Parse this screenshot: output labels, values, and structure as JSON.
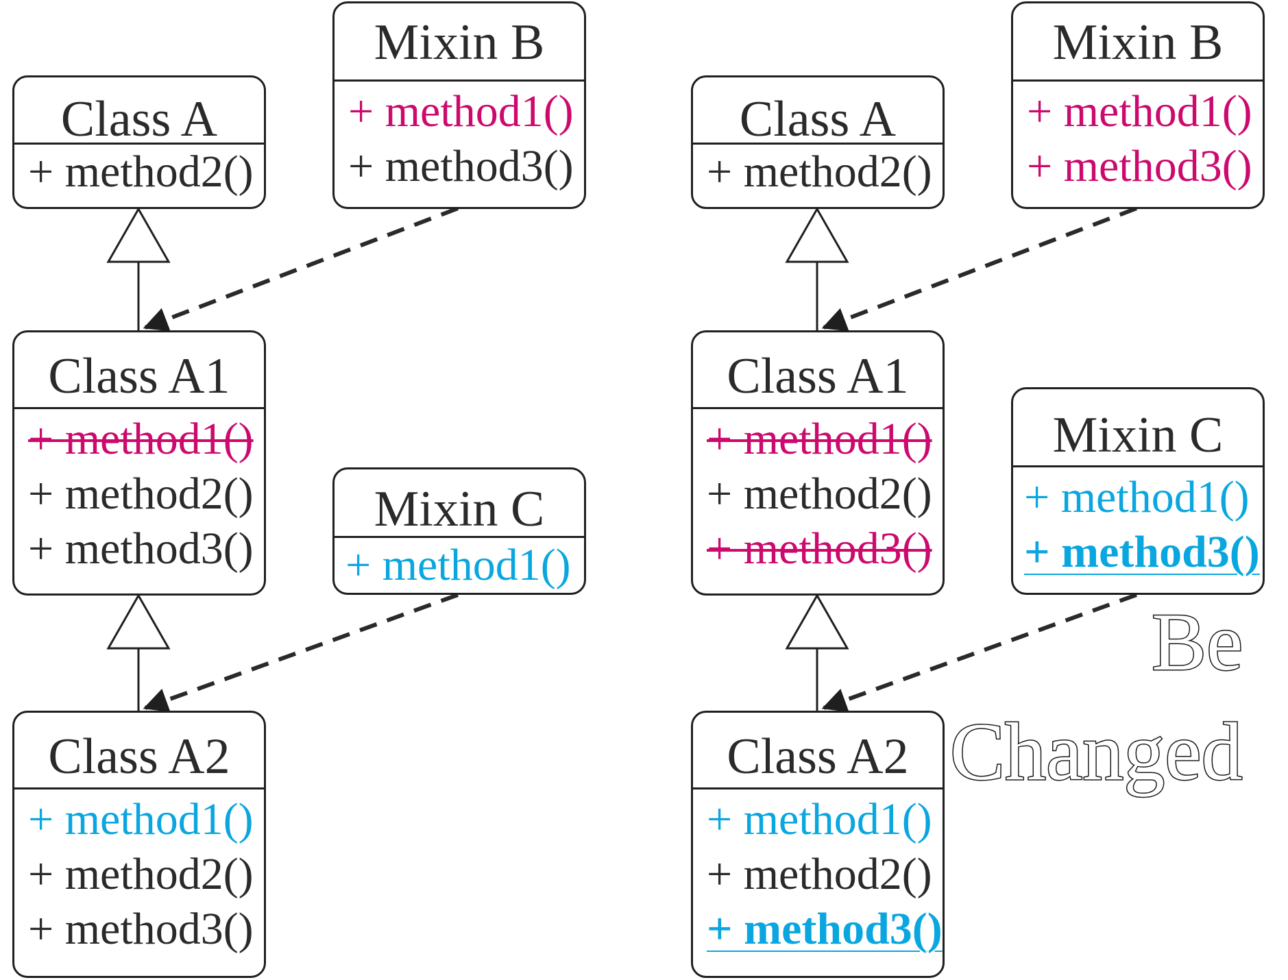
{
  "left": {
    "class_a": {
      "title": "Class A",
      "methods": [
        "+ method2()"
      ]
    },
    "mixin_b": {
      "title": "Mixin B",
      "methods": [
        "+ method1()",
        "+ method3()"
      ]
    },
    "class_a1": {
      "title": "Class A1",
      "methods": [
        "+ method1()",
        "+ method2()",
        "+ method3()"
      ]
    },
    "mixin_c": {
      "title": "Mixin C",
      "methods": [
        "+ method1()"
      ]
    },
    "class_a2": {
      "title": "Class A2",
      "methods": [
        "+ method1()",
        "+ method2()",
        "+ method3()"
      ]
    }
  },
  "right": {
    "class_a": {
      "title": "Class A",
      "methods": [
        "+ method2()"
      ]
    },
    "mixin_b": {
      "title": "Mixin B",
      "methods": [
        "+ method1()",
        "+ method3()"
      ]
    },
    "class_a1": {
      "title": "Class A1",
      "methods": [
        "+ method1()",
        "+ method2()",
        "+ method3()"
      ]
    },
    "mixin_c": {
      "title": "Mixin C",
      "methods": [
        "+ method1()",
        "+ method3()"
      ]
    },
    "class_a2": {
      "title": "Class A2",
      "methods": [
        "+ method1()",
        "+ method2()",
        "+ method3()"
      ]
    },
    "annotation": {
      "line1": "Be",
      "line2": "Changed"
    }
  },
  "colors": {
    "override_removed": "#cc0a6e",
    "mixin_c_method": "#0aa6df",
    "text": "#2a2a2a",
    "line": "#1f1f1f"
  }
}
